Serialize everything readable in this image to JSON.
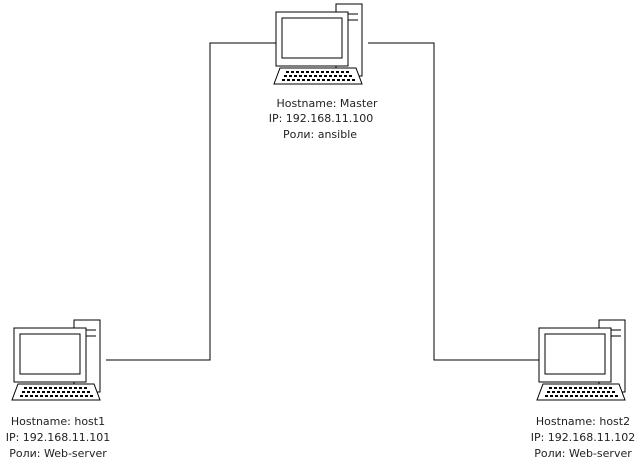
{
  "nodes": {
    "master": {
      "hostname": "Hostname: Master",
      "ip": "IP: 192.168.11.100",
      "role": "Роли: ansible"
    },
    "host1": {
      "hostname": "Hostname: host1",
      "ip": "IP: 192.168.11.101",
      "role": "Роли: Web-server"
    },
    "host2": {
      "hostname": "Hostname: host2",
      "ip": "IP: 192.168.11.102",
      "role": "Роли: Web-server"
    }
  },
  "colors": {
    "line": "#000000",
    "text": "#222222"
  }
}
